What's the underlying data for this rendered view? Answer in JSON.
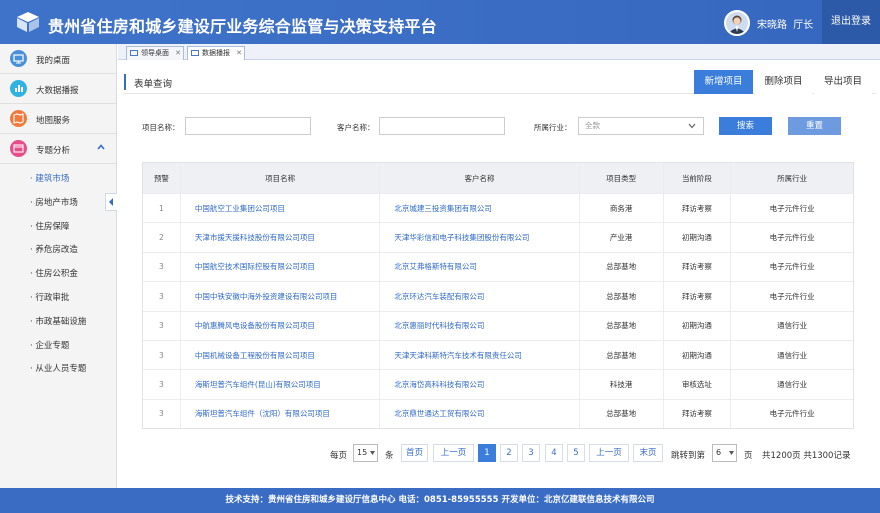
{
  "header": {
    "title": "贵州省住房和城乡建设厅业务综合监管与决策支持平台",
    "user_name": "宋晓路",
    "user_role": "厅长",
    "logout_label": "退出登录"
  },
  "sidebar": {
    "items": [
      {
        "label": "我的桌面",
        "icon": "desktop-icon",
        "color": "#4a90d9"
      },
      {
        "label": "大数据播报",
        "icon": "bar-chart-icon",
        "color": "#2fb3e0"
      },
      {
        "label": "地图服务",
        "icon": "map-icon",
        "color": "#f07a3c"
      },
      {
        "label": "专题分析",
        "icon": "folder-icon",
        "color": "#e74c8b"
      }
    ],
    "subitems": [
      "建筑市场",
      "房地产市场",
      "住房保障",
      "养危房改造",
      "住房公积金",
      "行政审批",
      "市政基础设施",
      "企业专题",
      "从业人员专题"
    ]
  },
  "tabs": [
    {
      "label": "领导桌面"
    },
    {
      "label": "数据播报"
    }
  ],
  "panel": {
    "title": "表单查询",
    "buttons": {
      "add": "新增项目",
      "delete": "删除项目",
      "export": "导出项目"
    }
  },
  "filters": {
    "project_label": "项目名称：",
    "client_label": "客户名称：",
    "industry_label": "所属行业：",
    "industry_value": "全款",
    "search_label": "搜索",
    "reset_label": "重置"
  },
  "table": {
    "headers": [
      "预警",
      "项目名称",
      "客户名称",
      "项目类型",
      "当前阶段",
      "所属行业"
    ],
    "rows": [
      {
        "warn": "1",
        "project": "中国航空工业集团公司项目",
        "client": "北京城建三投资集团有限公司",
        "type": "商务港",
        "stage": "拜访考察",
        "industry": "电子元件行业"
      },
      {
        "warn": "2",
        "project": "天津市援天援科技股份有限公司项目",
        "client": "天津华彩信和电子科技集团股份有限公司",
        "type": "产业港",
        "stage": "初期沟通",
        "industry": "电子元件行业"
      },
      {
        "warn": "3",
        "project": "中国航空技术国际控股有限公司项目",
        "client": "北京艾弗格斯特有限公司",
        "type": "总部基地",
        "stage": "拜访考察",
        "industry": "电子元件行业"
      },
      {
        "warn": "3",
        "project": "中国中铁安徽中海外投资建设有限公司项目",
        "client": "北京环达汽车装配有限公司",
        "type": "总部基地",
        "stage": "拜访考察",
        "industry": "电子元件行业"
      },
      {
        "warn": "3",
        "project": "中航惠腾风电设备股份有限公司项目",
        "client": "北京惠丽时代科技有限公司",
        "type": "总部基地",
        "stage": "初期沟通",
        "industry": "通信行业"
      },
      {
        "warn": "3",
        "project": "中国机械设备工程股份有限公司项目",
        "client": "天津天津科斯特汽车技术有限责任公司",
        "type": "总部基地",
        "stage": "初期沟通",
        "industry": "通信行业"
      },
      {
        "warn": "3",
        "project": "海斯坦普汽车组件(昆山)有限公司项目",
        "client": "北京海岱高科科技有限公司",
        "type": "科技港",
        "stage": "审核选址",
        "industry": "通信行业"
      },
      {
        "warn": "3",
        "project": "海斯坦普汽车组件（沈阳）有限公司项目",
        "client": "北京鼎世通达工贸有限公司",
        "type": "总部基地",
        "stage": "拜访考察",
        "industry": "电子元件行业"
      }
    ]
  },
  "pagination": {
    "per_page_label": "每页",
    "per_page_value": "15",
    "unit_label": "条",
    "first_label": "首页",
    "prev_label": "上一页",
    "pages": [
      "1",
      "2",
      "3",
      "4",
      "5"
    ],
    "next_label": "上一页",
    "last_label": "末页",
    "jump_label": "跳转到第",
    "jump_value": "6",
    "page_suffix": "页",
    "summary": "共1200页 共1300记录"
  },
  "footer": {
    "text": "技术支持：贵州省住房和城乡建设厅信息中心 电话：0851-85955555 开发单位：北京亿建联信息技术有限公司"
  }
}
